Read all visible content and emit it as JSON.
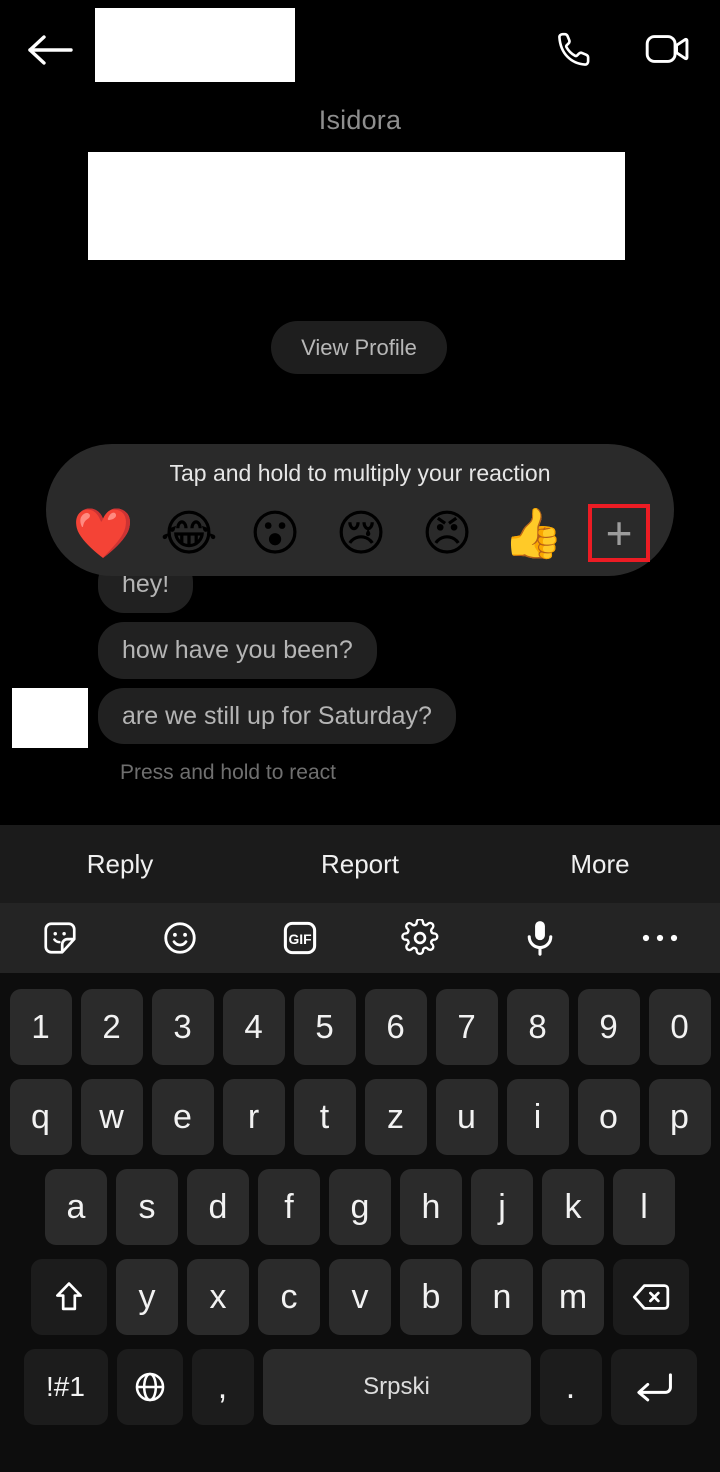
{
  "header": {
    "back_icon": "back-arrow-icon",
    "title_redacted": true,
    "call_icon": "phone-call-icon",
    "video_icon": "video-call-icon"
  },
  "profile": {
    "name": "Isidora",
    "view_profile_label": "View Profile",
    "redacted_banner": true
  },
  "reaction_bar": {
    "title": "Tap and hold to multiply your reaction",
    "highlight_color": "#ec1c24",
    "background": "#2a2a2a",
    "reactions": [
      {
        "name": "heart-reaction",
        "glyph": "❤️"
      },
      {
        "name": "laugh-reaction",
        "glyph": "😂"
      },
      {
        "name": "wow-reaction",
        "glyph": "😮"
      },
      {
        "name": "sad-reaction",
        "glyph": "😢"
      },
      {
        "name": "angry-reaction",
        "glyph": "😠"
      },
      {
        "name": "thumbsup-reaction",
        "glyph": "👍"
      }
    ],
    "add_reaction_label": "+"
  },
  "messages": [
    {
      "text": "hey!"
    },
    {
      "text": "how have you been?"
    },
    {
      "text": "are we still up for Saturday?"
    }
  ],
  "message_hint": "Press and hold to react",
  "action_bar": {
    "items": [
      {
        "label": "Reply"
      },
      {
        "label": "Report"
      },
      {
        "label": "More"
      }
    ]
  },
  "keyboard_toolbar": {
    "items": [
      {
        "name": "sticker-icon"
      },
      {
        "name": "emoji-icon"
      },
      {
        "name": "gif-icon",
        "label": "GIF"
      },
      {
        "name": "gear-icon"
      },
      {
        "name": "microphone-icon"
      },
      {
        "name": "more-options-icon"
      }
    ]
  },
  "keyboard": {
    "row_numbers": [
      "1",
      "2",
      "3",
      "4",
      "5",
      "6",
      "7",
      "8",
      "9",
      "0"
    ],
    "row_top": [
      "q",
      "w",
      "e",
      "r",
      "t",
      "z",
      "u",
      "i",
      "o",
      "p"
    ],
    "row_home": [
      "a",
      "s",
      "d",
      "f",
      "g",
      "h",
      "j",
      "k",
      "l"
    ],
    "row_bottom": [
      "y",
      "x",
      "c",
      "v",
      "b",
      "n",
      "m"
    ],
    "shift_label": "shift-icon",
    "backspace_label": "backspace-icon",
    "symbols_label": "!#1",
    "globe_label": "globe-icon",
    "comma_label": ",",
    "space_label": "Srpski",
    "period_label": ".",
    "enter_label": "enter-icon"
  }
}
